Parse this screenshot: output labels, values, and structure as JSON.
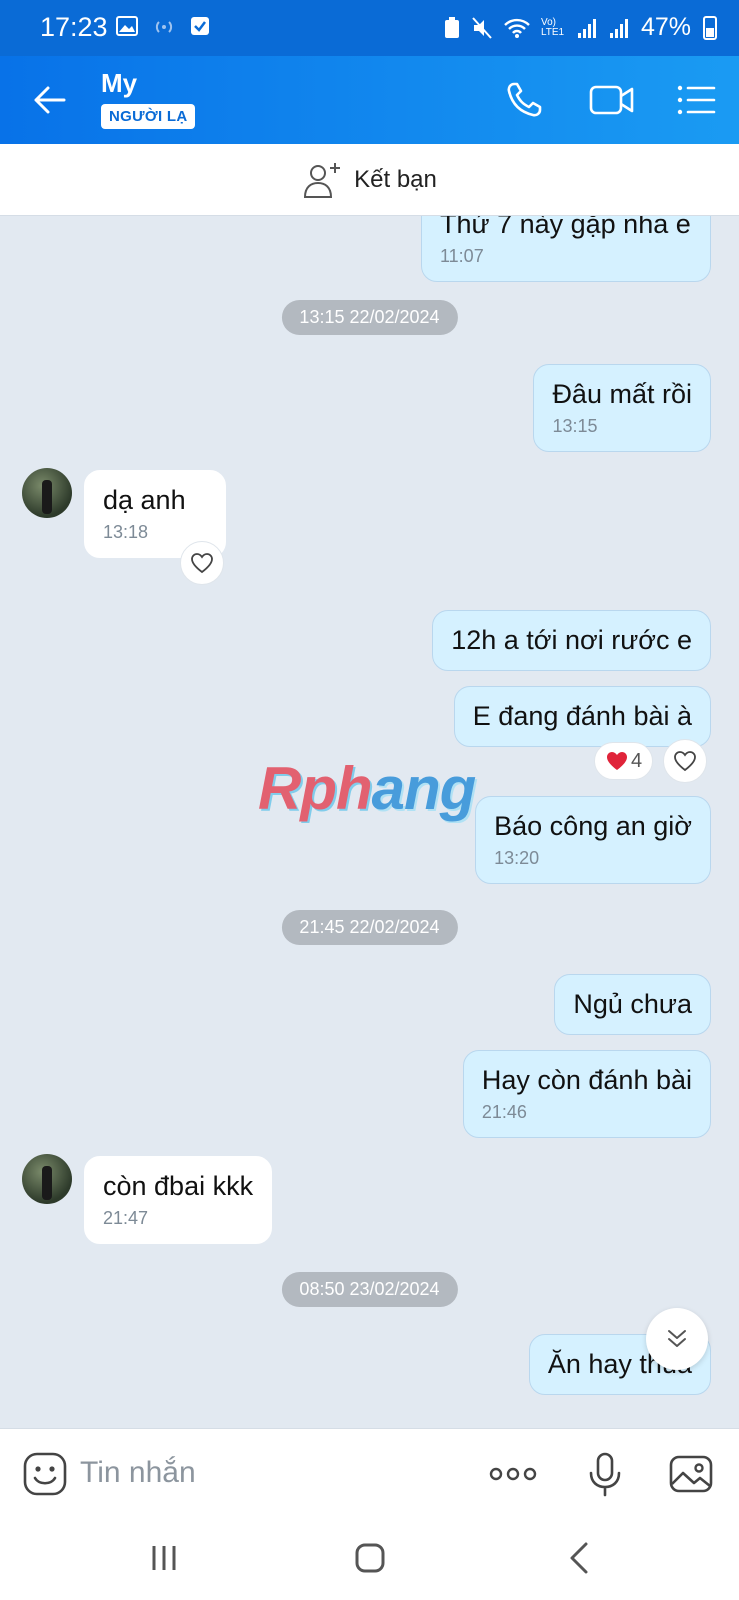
{
  "status": {
    "time": "17:23",
    "battery": "47%",
    "net_label": "Vo) LTE1"
  },
  "header": {
    "name": "My",
    "badge": "NGƯỜI LẠ"
  },
  "add_friend": {
    "label": "Kết bạn"
  },
  "messages": [
    {
      "dir": "out",
      "text": "Thứ 7 này gặp nha e",
      "time": "11:07"
    },
    {
      "type": "date",
      "text": "13:15 22/02/2024"
    },
    {
      "dir": "out",
      "text": "Đâu mất rồi",
      "time": "13:15"
    },
    {
      "dir": "in",
      "text": "dạ anh",
      "time": "13:18"
    },
    {
      "dir": "out",
      "text": "12h a tới nơi rước e"
    },
    {
      "dir": "out",
      "text": "E đang đánh bài à",
      "reaction_count": "4"
    },
    {
      "dir": "out",
      "text": "Báo công an giờ",
      "time": "13:20"
    },
    {
      "type": "date",
      "text": "21:45 22/02/2024"
    },
    {
      "dir": "out",
      "text": "Ngủ chưa"
    },
    {
      "dir": "out",
      "text": "Hay còn đánh bài",
      "time": "21:46"
    },
    {
      "dir": "in",
      "text": "còn đbai kkk",
      "time": "21:47"
    },
    {
      "type": "date",
      "text": "08:50 23/02/2024"
    },
    {
      "dir": "out",
      "text": "Ăn hay thua"
    }
  ],
  "watermark": {
    "text_a": "Rph",
    "text_b": "ang"
  },
  "composer": {
    "placeholder": "Tin nhắn"
  },
  "icons": {
    "back": "arrow-left-icon",
    "call": "phone-icon",
    "video": "video-icon",
    "menu": "list-icon",
    "add_friend": "user-plus-icon",
    "sticker": "smile-icon",
    "more": "more-dots-icon",
    "mic": "mic-icon",
    "image": "image-icon",
    "heart": "heart-icon",
    "reaction": "red-heart-icon",
    "scroll": "double-chevron-down-icon"
  },
  "colors": {
    "header": "#0a6bd6",
    "bubble_out": "#d5f1ff",
    "bubble_in": "#ffffff",
    "chat_bg": "#e2e9f1"
  }
}
